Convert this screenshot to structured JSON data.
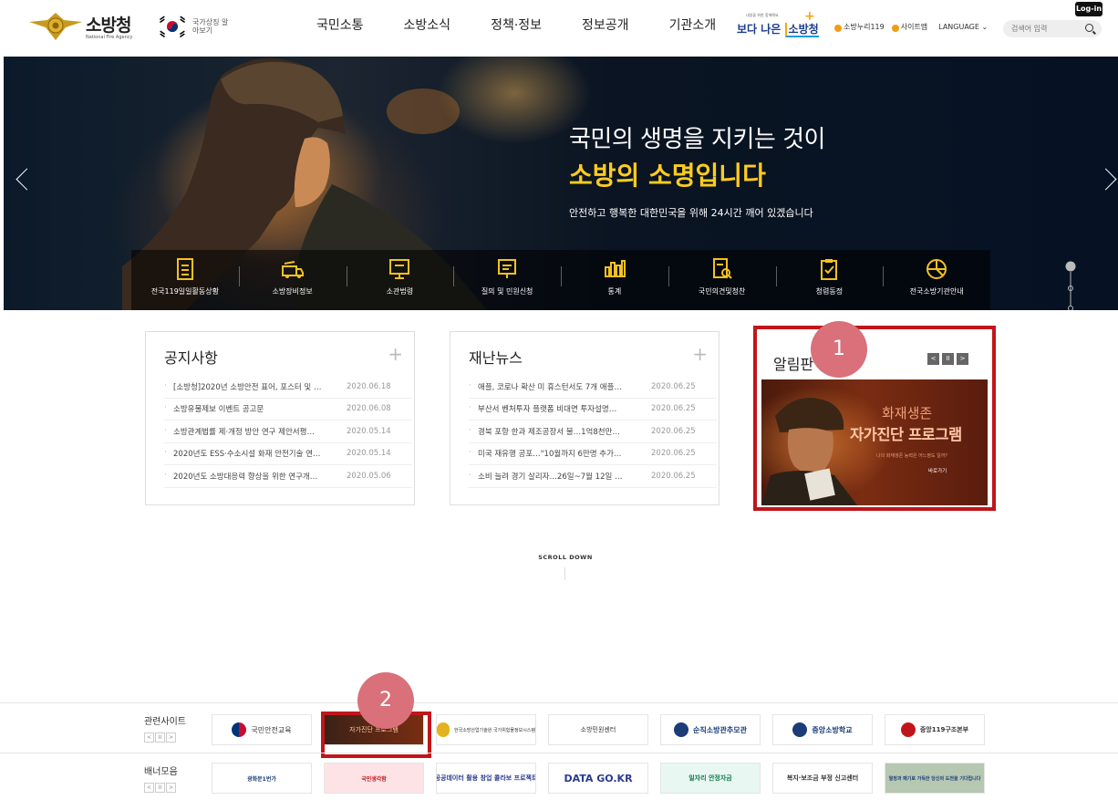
{
  "header": {
    "logo_title": "소방청",
    "logo_sub": "National Fire Agency",
    "symbol_text": "국가상징 알아보기",
    "gnb": [
      "국민소통",
      "소방소식",
      "정책·정보",
      "정보공개",
      "기관소개"
    ],
    "better_small": "내일을 위한 함께해요",
    "better_main_a": "보다 나은",
    "better_main_b": "소방청",
    "util_1": "소방누리119",
    "util_2": "사이트맵",
    "language": "LANGUAGE ⌄",
    "search_placeholder": "검색어 입력",
    "login": "Log-in"
  },
  "hero": {
    "line1": "국민의 생명을 지키는 것이",
    "line2": "소방의 소명입니다",
    "line3": "안전하고 행복한 대한민국을 위해 24시간 깨어 있겠습니다",
    "quick": [
      {
        "label": "전국119일일활동상황",
        "icon": "document-icon"
      },
      {
        "label": "소방장비정보",
        "icon": "firetruck-icon"
      },
      {
        "label": "소관법령",
        "icon": "monitor-icon"
      },
      {
        "label": "질의 및 민원신청",
        "icon": "inquiry-icon"
      },
      {
        "label": "통계",
        "icon": "bar-chart-icon"
      },
      {
        "label": "국민의견및청찬",
        "icon": "search-document-icon"
      },
      {
        "label": "청렴동정",
        "icon": "checklist-icon"
      },
      {
        "label": "전국소방기관안내",
        "icon": "pie-chart-icon"
      }
    ]
  },
  "notice_board": {
    "title": "공지사항",
    "rows": [
      {
        "text": "[소방청]2020년 소방안전 표어, 포스터 및 …",
        "date": "2020.06.18"
      },
      {
        "text": "소방유물제보 이벤트 공고문",
        "date": "2020.06.08"
      },
      {
        "text": "소방관계법률 제·개정 방안 연구 제안서평…",
        "date": "2020.05.14"
      },
      {
        "text": "2020년도 ESS·수소시설 화재 안전기술 연…",
        "date": "2020.05.14"
      },
      {
        "text": "2020년도 소방대응력 향상을 위한 연구개…",
        "date": "2020.05.06"
      }
    ]
  },
  "news_board": {
    "title": "재난뉴스",
    "rows": [
      {
        "text": "애플, 코로나 확산 미 휴스턴서도 7개 애플…",
        "date": "2020.06.25"
      },
      {
        "text": "부산서 벤처투자 플랫폼 비대면 투자설명…",
        "date": "2020.06.25"
      },
      {
        "text": "경북 포항 한과 제조공장서 불…1억8천만…",
        "date": "2020.06.25"
      },
      {
        "text": "미국 재유행 공포…\"10월까지 6만명 추가…",
        "date": "2020.06.25"
      },
      {
        "text": "소비 늘려 경기 살리자…26일~7월 12일 …",
        "date": "2020.06.25"
      }
    ]
  },
  "popup": {
    "title": "알림판",
    "ctrl_prev": "<",
    "ctrl_pause": "II",
    "ctrl_next": ">",
    "banner_t1": "화재생존",
    "banner_t2": "자가진단 프로그램",
    "banner_t3": "나의 화재생존 능력은 어느정도 일까?",
    "banner_t4": "바로가기"
  },
  "badges": {
    "one": "1",
    "two": "2"
  },
  "scroll_down": "SCROLL DOWN",
  "related": {
    "title": "관련사이트",
    "ctrl": [
      "<",
      "II",
      ">"
    ],
    "sites": [
      "국민안전교육",
      "자가진단 프로그램",
      "한국소방산업기술원 국가위험물정보시스템",
      "소방민원센터",
      "순직소방관추모관",
      "중앙소방학교",
      "중앙119구조본부"
    ]
  },
  "banners": {
    "title": "배너모음",
    "ctrl": [
      "<",
      "II",
      ">"
    ],
    "items": [
      "광화문1번가",
      "국민생각함",
      "공공데이터 활용 창업 콜라보 프로젝트",
      "DATA GO.KR",
      "일자리 안정자금",
      "복지·보조금 부정 신고센터",
      "열정과 패기로 가득한 당신의 도전을 기다립니다"
    ]
  }
}
